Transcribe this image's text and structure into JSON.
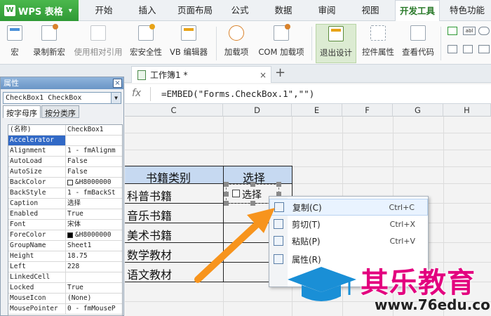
{
  "app": {
    "brand": "WPS 表格",
    "brand_caret": "▾"
  },
  "menu": [
    {
      "label": "开始"
    },
    {
      "label": "插入"
    },
    {
      "label": "页面布局"
    },
    {
      "label": "公式"
    },
    {
      "label": "数据"
    },
    {
      "label": "审阅"
    },
    {
      "label": "视图"
    },
    {
      "label": "开发工具",
      "active": true
    },
    {
      "label": "特色功能"
    }
  ],
  "ribbon": {
    "macro": "宏",
    "record_macro": "录制新宏",
    "relative_ref": "使用相对引用",
    "macro_security": "宏安全性",
    "vb_editor": "VB 编辑器",
    "addins": "加载项",
    "com_addins": "COM 加载项",
    "exit_design": "退出设计",
    "control_props": "控件属性",
    "view_code": "查看代码",
    "mini_right": "abl"
  },
  "tabs": {
    "doc": "工作簿1 *",
    "close": "×",
    "new": "+"
  },
  "formula": {
    "fx": "fx",
    "text": "=EMBED(\"Forms.CheckBox.1\",\"\")"
  },
  "properties": {
    "title": "属性",
    "close": "×",
    "object": "CheckBox1 CheckBox",
    "tab_alpha": "按字母序",
    "tab_category": "按分类序",
    "rows": [
      {
        "name": "(名称)",
        "value": "CheckBox1"
      },
      {
        "name": "Accelerator",
        "value": "",
        "selected": true
      },
      {
        "name": "Alignment",
        "value": "1 - fmAlignm"
      },
      {
        "name": "AutoLoad",
        "value": "False"
      },
      {
        "name": "AutoSize",
        "value": "False"
      },
      {
        "name": "BackColor",
        "value": "&H8000000",
        "swatch": "#ffffff"
      },
      {
        "name": "BackStyle",
        "value": "1 - fmBackSt"
      },
      {
        "name": "Caption",
        "value": "选择"
      },
      {
        "name": "Enabled",
        "value": "True"
      },
      {
        "name": "Font",
        "value": "宋体"
      },
      {
        "name": "ForeColor",
        "value": "&H8000000",
        "swatch": "#000000"
      },
      {
        "name": "GroupName",
        "value": "Sheet1"
      },
      {
        "name": "Height",
        "value": "18.75"
      },
      {
        "name": "Left",
        "value": "228"
      },
      {
        "name": "LinkedCell",
        "value": ""
      },
      {
        "name": "Locked",
        "value": "True"
      },
      {
        "name": "MouseIcon",
        "value": "(None)"
      },
      {
        "name": "MousePointer",
        "value": "0 - fmMouseP"
      }
    ]
  },
  "sheet": {
    "columns": [
      "C",
      "D",
      "E",
      "F",
      "G",
      "H"
    ],
    "header": {
      "category": "书籍类别",
      "choice": "选择"
    },
    "rows": [
      "科普书籍",
      "音乐书籍",
      "美术书籍",
      "数学教材",
      "语文教材"
    ],
    "checkbox_caption": "选择"
  },
  "context_menu": [
    {
      "label": "复制(C)",
      "shortcut": "Ctrl+C",
      "icon": "copy-icon",
      "highlight": true
    },
    {
      "label": "剪切(T)",
      "shortcut": "Ctrl+X",
      "icon": "scissors-icon"
    },
    {
      "label": "粘贴(P)",
      "shortcut": "Ctrl+V",
      "icon": "paste-icon"
    },
    {
      "label": "属性(R)",
      "shortcut": "",
      "icon": "properties-icon"
    }
  ],
  "watermark": {
    "name": "其乐教育",
    "url": "www.76edu.com"
  },
  "colors": {
    "accent_green": "#2f9a35",
    "header_fill": "#c6d9f1",
    "arrow": "#f7941d",
    "watermark": "#e3007f"
  }
}
